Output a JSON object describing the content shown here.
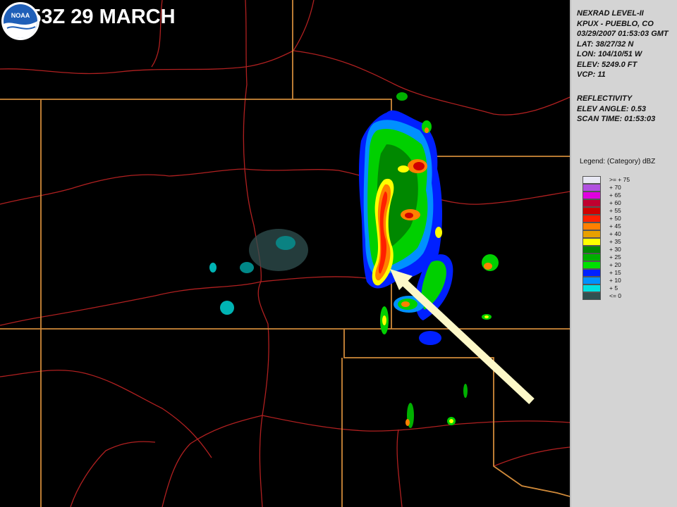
{
  "slide": {
    "title": "0153Z 29 MARCH"
  },
  "radar_header": {
    "lines": [
      "NEXRAD LEVEL-II",
      "KPUX - PUEBLO, CO",
      "03/29/2007 01:53:03 GMT",
      "LAT: 38/27/32 N",
      "LON: 104/10/51 W",
      "ELEV: 5249.0 FT",
      "VCP: 11"
    ]
  },
  "product": {
    "name": "REFLECTIVITY",
    "elev_angle": "ELEV ANGLE: 0.53",
    "scan_time": "SCAN TIME: 01:53:03"
  },
  "legend": {
    "title": "Legend: (Category) dBZ",
    "items": [
      {
        "label": ">= + 75",
        "color": "#e8e8f4"
      },
      {
        "label": "+ 70",
        "color": "#b050e0"
      },
      {
        "label": "+ 65",
        "color": "#e000e0"
      },
      {
        "label": "+ 60",
        "color": "#c00030"
      },
      {
        "label": "+ 55",
        "color": "#d00000"
      },
      {
        "label": "+ 50",
        "color": "#ff2000"
      },
      {
        "label": "+ 45",
        "color": "#ff8000"
      },
      {
        "label": "+ 40",
        "color": "#e8a000"
      },
      {
        "label": "+ 35",
        "color": "#ffff00"
      },
      {
        "label": "+ 30",
        "color": "#008800"
      },
      {
        "label": "+ 25",
        "color": "#00b000"
      },
      {
        "label": "+ 20",
        "color": "#00e000"
      },
      {
        "label": "+ 15",
        "color": "#0020ff"
      },
      {
        "label": "+ 10",
        "color": "#0090ff"
      },
      {
        "label": "+ 5",
        "color": "#00e0e0"
      },
      {
        "label": "<= 0",
        "color": "#305050"
      }
    ]
  },
  "logo": {
    "text": "NOAA"
  },
  "colors": {
    "state_border": "#d08a3a",
    "county_road": "#b02020",
    "panel_bg": "#d4d4d4",
    "arrow": "#fdf8c8"
  }
}
